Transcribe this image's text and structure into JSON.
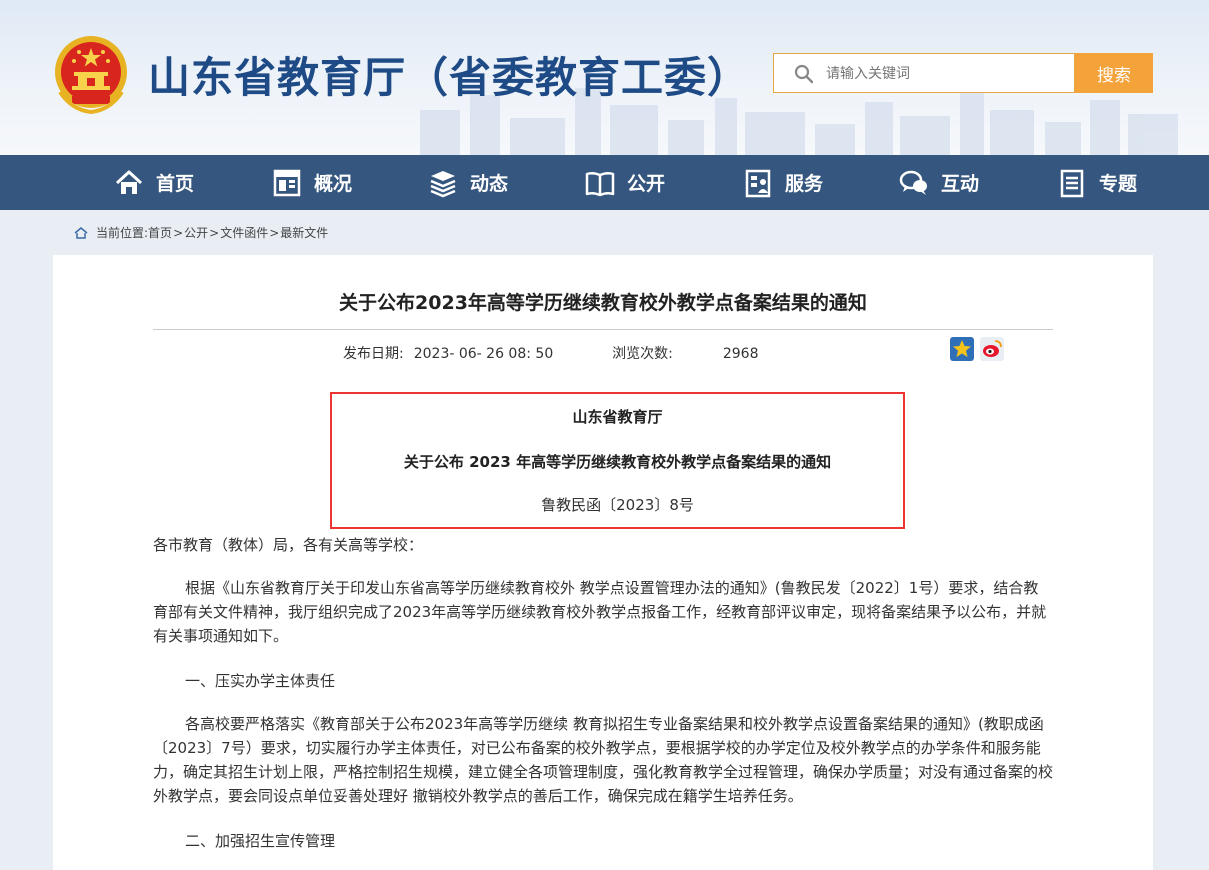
{
  "header": {
    "site_title": "山东省教育厅（省委教育工委）",
    "search_placeholder": "请输入关键词",
    "search_button": "搜索"
  },
  "nav": {
    "items": [
      {
        "label": "首页",
        "icon": "home-icon"
      },
      {
        "label": "概况",
        "icon": "overview-icon"
      },
      {
        "label": "动态",
        "icon": "news-icon"
      },
      {
        "label": "公开",
        "icon": "book-icon"
      },
      {
        "label": "服务",
        "icon": "service-icon"
      },
      {
        "label": "互动",
        "icon": "chat-icon"
      },
      {
        "label": "专题",
        "icon": "topic-icon"
      }
    ]
  },
  "breadcrumb": {
    "prefix": "当前位置:",
    "items": [
      "首页",
      "公开",
      "文件函件",
      "最新文件"
    ],
    "separator": ">"
  },
  "article": {
    "title": "关于公布2023年高等学历继续教育校外教学点备案结果的通知",
    "date_label": "发布日期:",
    "date_value": "2023- 06- 26 08: 50",
    "views_label": "浏览次数:",
    "views_value": "2968",
    "doc_box": {
      "issuer": "山东省教育厅",
      "doc_title": "关于公布 2023 年高等学历继续教育校外教学点备案结果的通知",
      "doc_number": "鲁教民函〔2023〕8号"
    },
    "salutation": "各市教育（教体）局，各有关高等学校：",
    "para1": "根据《山东省教育厅关于印发山东省高等学历继续教育校外 教学点设置管理办法的通知》(鲁教民发〔2022〕1号）要求，结合教育部有关文件精神，我厅组织完成了2023年高等学历继续教育校外教学点报备工作，经教育部评议审定，现将备案结果予以公布，并就有关事项通知如下。",
    "heading1": "一、压实办学主体责任",
    "para2": "各高校要严格落实《教育部关于公布2023年高等学历继续 教育拟招生专业备案结果和校外教学点设置备案结果的通知》(教职成函〔2023〕7号）要求，切实履行办学主体责任，对已公布备案的校外教学点，要根据学校的办学定位及校外教学点的办学条件和服务能力，确定其招生计划上限，严格控制招生规模，建立健全各项管理制度，强化教育教学全过程管理，确保办学质量；对没有通过备案的校外教学点，要会同设点单位妥善处理好 撤销校外教学点的善后工作，确保完成在籍学生培养任务。",
    "heading2": "二、加强招生宣传管理"
  },
  "colors": {
    "title_blue": "#1e4a86",
    "nav_bg": "#35567e",
    "search_orange": "#f4a23a",
    "doc_box_border": "#e33333"
  }
}
